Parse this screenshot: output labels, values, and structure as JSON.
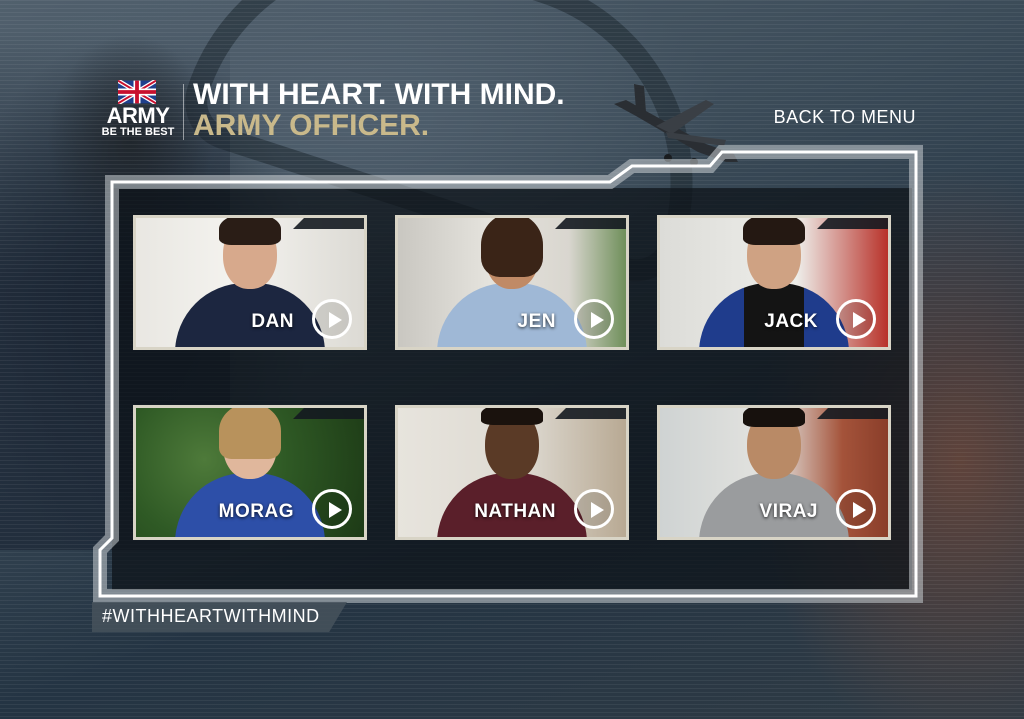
{
  "header": {
    "logo_text": "ARMY",
    "logo_tagline": "BE THE BEST",
    "headline_line1": "WITH HEART. WITH MIND.",
    "headline_line2": "ARMY OFFICER.",
    "back_to_menu": "BACK TO MENU"
  },
  "tiles": [
    {
      "name": "DAN"
    },
    {
      "name": "JEN"
    },
    {
      "name": "JACK"
    },
    {
      "name": "MORAG"
    },
    {
      "name": "NATHAN"
    },
    {
      "name": "VIRAJ"
    }
  ],
  "footer": {
    "hashtag": "#WITHHEARTWITHMIND"
  },
  "colors": {
    "accent_gold": "#c9b98b",
    "frame_white": "#ffffff",
    "tile_border": "#d8d4c6"
  }
}
